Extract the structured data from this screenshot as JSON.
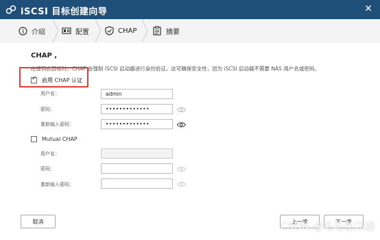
{
  "window": {
    "title": "iSCSI 目标创建向导",
    "close_glyph": "✕",
    "accent": "#1f4e79"
  },
  "steps": [
    {
      "label": "介绍",
      "icon": "info-icon"
    },
    {
      "label": "配置",
      "icon": "config-icon"
    },
    {
      "label": "CHAP",
      "icon": "shield-check-icon",
      "active": true
    },
    {
      "label": "摘要",
      "icon": "clipboard-icon"
    }
  ],
  "section": {
    "title": "CHAP ,",
    "description": "在接到此目标时，CHAP 会强制 iSCSI 启动器进行身份验证。这可确保安全性，因为 iSCSI 启动器不需要 NAS 用户名或密码。"
  },
  "chap": {
    "checkbox_label": "启用 CHAP 认证",
    "checked": true,
    "username_label": "用户名：",
    "username_value": "admin",
    "password_label": "密码：",
    "password_value": "•••••••••••••",
    "confirm_label": "重新输入密码：",
    "confirm_value": "•••••••••••••"
  },
  "mutual_chap": {
    "checkbox_label": "Mutual CHAP",
    "checked": false,
    "username_label": "用户名：",
    "password_label": "密码：",
    "confirm_label": "重新输入密码："
  },
  "footer": {
    "cancel_label": "取消",
    "prev_label": "上一步",
    "next_label": "下一步"
  },
  "watermark": "CSDN @毛毛在江湖",
  "highlight_color": "#e53935"
}
